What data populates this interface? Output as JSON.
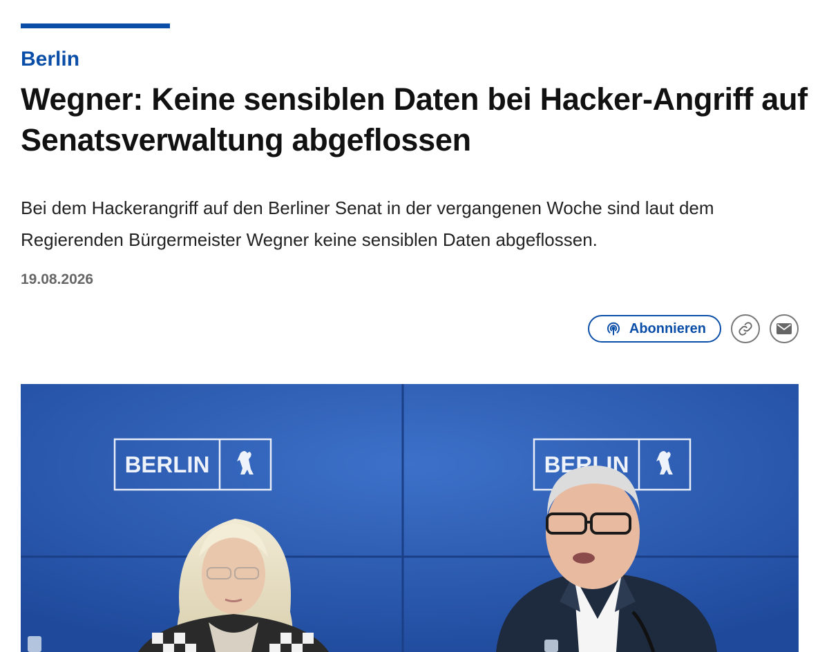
{
  "article": {
    "section": "Berlin",
    "headline": "Wegner: Keine sensiblen Daten bei Hacker-Angriff auf Senatsverwaltung abgeflossen",
    "teaser": "Bei dem Hackerangriff auf den Berliner Senat in der vergangenen Woche sind laut dem Regierenden Bürgermeister Wegner keine sensiblen Daten abgeflossen.",
    "date": "19.08.2026"
  },
  "actions": {
    "subscribe_label": "Abonnieren",
    "link_icon": "link-icon",
    "mail_icon": "mail-icon",
    "podcast_icon": "podcast-icon"
  },
  "photo": {
    "backdrop_text_left": "BERLIN",
    "backdrop_text_right": "BERLIN"
  },
  "colors": {
    "accent": "#0a4ea8",
    "backdrop": "#2c5cb3"
  }
}
